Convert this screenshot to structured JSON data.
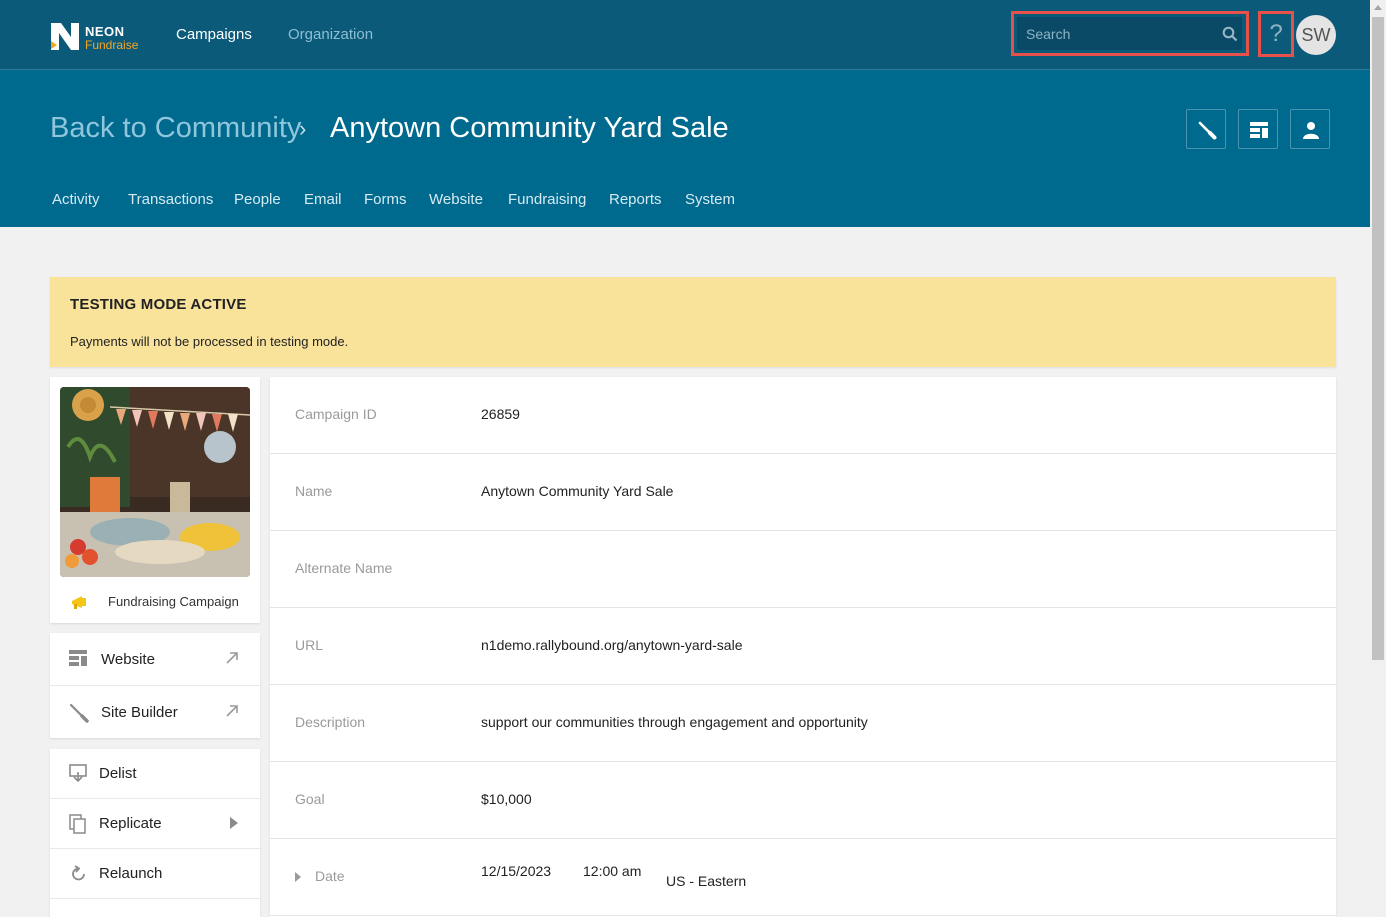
{
  "topbar": {
    "logo_line1": "NEON",
    "logo_line2": "Fundraise",
    "nav": [
      "Campaigns",
      "Organization"
    ],
    "search_placeholder": "Search",
    "help_label": "?",
    "avatar_initials": "SW"
  },
  "header": {
    "back_link": "Back to Community",
    "separator": "›",
    "title": "Anytown Community Yard Sale",
    "subnav": [
      "Activity",
      "Transactions",
      "People",
      "Email",
      "Forms",
      "Website",
      "Fundraising",
      "Reports",
      "System"
    ]
  },
  "banner": {
    "title": "TESTING MODE ACTIVE",
    "text": "Payments will not be processed in testing mode."
  },
  "sidebar": {
    "campaign_type": "Fundraising Campaign",
    "links": [
      "Website",
      "Site Builder"
    ],
    "actions": [
      "Delist",
      "Replicate",
      "Relaunch"
    ]
  },
  "details": {
    "campaign_id_label": "Campaign ID",
    "campaign_id": "26859",
    "name_label": "Name",
    "name": "Anytown Community Yard Sale",
    "alt_name_label": "Alternate Name",
    "alt_name": "",
    "url_label": "URL",
    "url": "n1demo.rallybound.org/anytown-yard-sale",
    "description_label": "Description",
    "description": "support our communities through engagement and opportunity",
    "goal_label": "Goal",
    "goal": "$10,000",
    "date_label": "Date",
    "date": "12/15/2023",
    "time": "12:00 am",
    "timezone": "US - Eastern"
  },
  "colors": {
    "topbar": "#0c5a7a",
    "header": "#006a8e",
    "banner": "#f9e39b",
    "highlight": "#e8504a",
    "logo_accent": "#f5a623"
  }
}
